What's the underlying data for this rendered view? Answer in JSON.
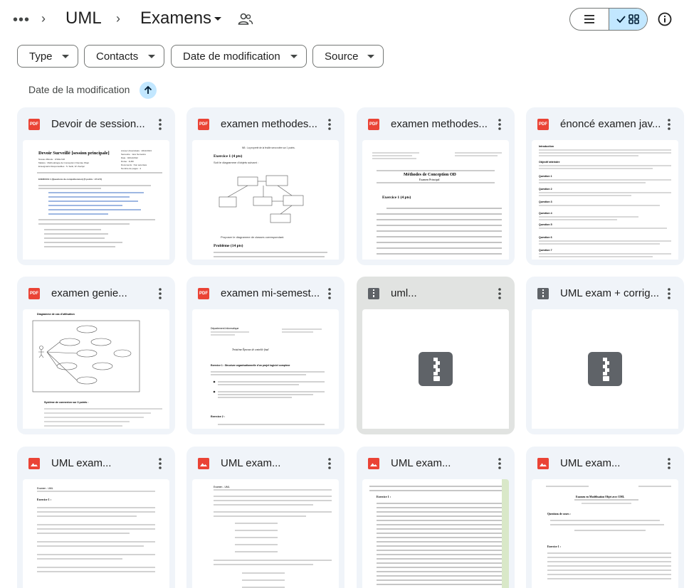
{
  "breadcrumb": {
    "more_label": "•••",
    "sep": "›",
    "items": [
      "UML",
      "Examens"
    ]
  },
  "filters": [
    "Type",
    "Contacts",
    "Date de modification",
    "Source"
  ],
  "sort": {
    "label": "Date de la modification",
    "direction": "ascending"
  },
  "colors": {
    "accent": "#c2e7ff",
    "card_bg": "#f0f4f9",
    "pdf_red": "#ea4335",
    "zip_gray": "#5f6368"
  },
  "files": [
    {
      "name": "Devoir de session...",
      "type": "pdf"
    },
    {
      "name": "examen methodes...",
      "type": "pdf"
    },
    {
      "name": "examen methodes...",
      "type": "pdf"
    },
    {
      "name": "énoncé examen jav...",
      "type": "pdf"
    },
    {
      "name": "examen genie...",
      "type": "pdf"
    },
    {
      "name": "examen mi-semest...",
      "type": "pdf"
    },
    {
      "name": "uml...",
      "type": "zip"
    },
    {
      "name": "UML exam + corrig...",
      "type": "zip"
    },
    {
      "name": "UML exam...",
      "type": "image"
    },
    {
      "name": "UML exam...",
      "type": "image"
    },
    {
      "name": "UML exam...",
      "type": "image"
    },
    {
      "name": "UML exam...",
      "type": "image"
    }
  ],
  "file_type_badge": {
    "pdf": "PDF"
  },
  "thumbnails": {
    "t0": {
      "title": "Devoir Surveillé [session principale]",
      "meta": [
        "Année Universitaire : 2012/2013",
        "Semestre : 1ère Semestre",
        "Date : 04/12/2012",
        "Durée : 1H30",
        "Documents : Non autorisés",
        "Nombre de pages : 4"
      ],
      "lines": [
        "Niveau d'Etude : LISIEL/GR",
        "Matière : Méthodologie de Conception Orientée Objet",
        "Enseignants Responsables : S. Seiki, W. Zouhjer",
        "EXERCICE 1 (Questions de compréhension) (5 points : 2.5.2.5)"
      ]
    },
    "t1": {
      "header": "NB : La propreté de la feuille sera notée sur 1 points.",
      "ex1": "Exercice 1 (4 pts)",
      "ex1_text": "Soit le diagramme d'objets suivant :",
      "prop": "Proposer le diagramme de classes correspondant.",
      "prob": "Problème (14 pts)"
    },
    "t2": {
      "title": "Méthodes de Conception OD",
      "subtitle": "Examen Principal",
      "ex1": "Exercice 1 (4 pts)"
    },
    "t3": {
      "h1": "Introduction",
      "h2": "Objectif atteindre",
      "q": [
        "Question 1",
        "Question 2",
        "Question 3",
        "Question 4",
        "Question 5",
        "Question 6",
        "Question 7"
      ]
    },
    "t4": {
      "title": "Diagramme de cas d'utilisation",
      "footer": "Système de connexion sur 3 points :"
    },
    "t5": {
      "dept": "Département Informatique",
      "title": "Troisième Épreuve de contrôle final",
      "ex1": "Exercice 1 : Structure organisationnelle d'un projet logiciel complexe",
      "ex2": "Exercice 2 :"
    },
    "t8": {
      "head": "Examen - UML",
      "ex1": "Exercice 1 :"
    },
    "t9": {
      "head": "Examen - UML"
    },
    "t10": {
      "ex1": "Exercice 1 :"
    },
    "t11": {
      "title": "Examen en Modélisation Objet avec UML",
      "sub": "Questions de cours :",
      "ex1": "Exercice 1 :"
    }
  }
}
